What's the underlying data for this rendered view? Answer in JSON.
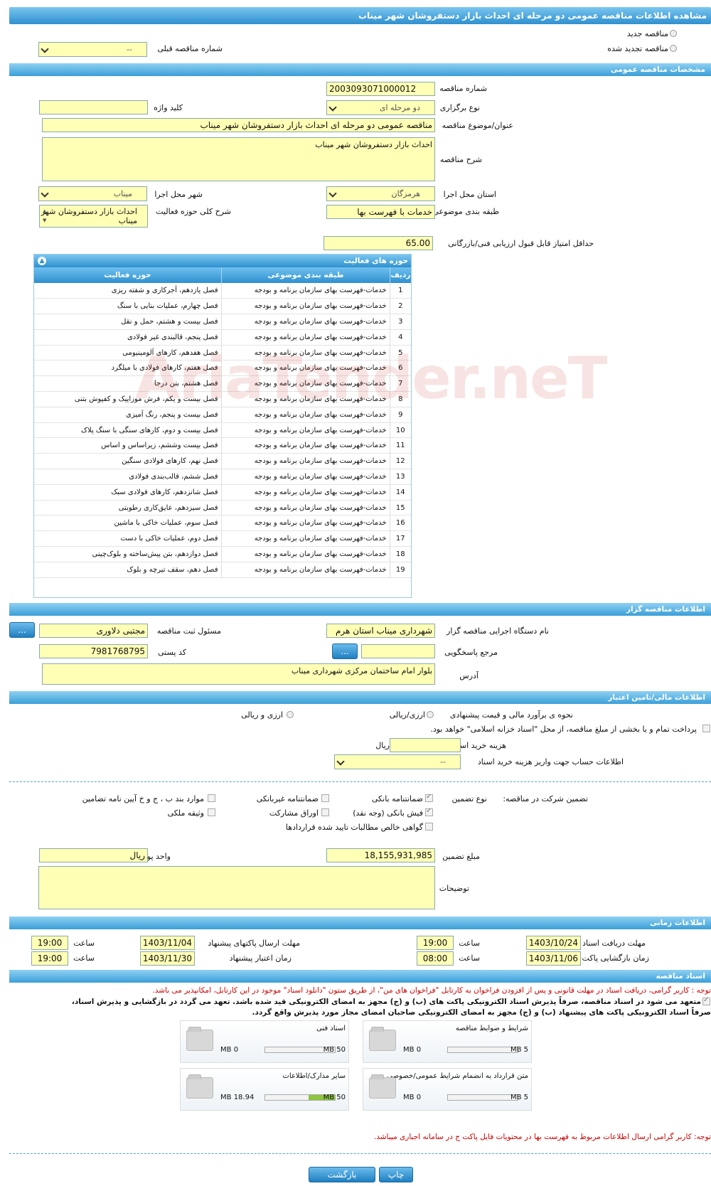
{
  "page": {
    "title": "مشاهده اطلاعات مناقصه عمومی دو مرحله ای احداث بازار دستفروشان شهر میناب"
  },
  "top": {
    "new_label": "مناقصه جدید",
    "renewed_label": "مناقصه تجدید شده",
    "prev_label": "شماره مناقصه قبلی",
    "prev_value": "--"
  },
  "general": {
    "header": "مشخصات مناقصه عمومی",
    "number_label": "شماره مناقصه",
    "number": "2003093071000012",
    "type_label": "نوع برگزاری",
    "type_value": "دو مرحله ای",
    "keyword_label": "کلید واژه",
    "keyword": "",
    "subject_label": "عنوان/موضوع مناقصه",
    "subject": "مناقصه عمومی دو مرحله ای احداث بازار دستفروشان شهر میناب",
    "desc_label": "شرح مناقصه",
    "desc": "احداث بازار دستفروشان شهر میناب",
    "province_label": "استان محل اجرا",
    "province": "هرمزگان",
    "city_label": "شهر محل اجرا",
    "city": "میناب",
    "category_label": "طبقه بندی موضوعی",
    "category": "خدمات با فهرست بها",
    "scope_label": "شرح کلی حوزه فعالیت",
    "scope": "احداث بازار دستفروشان شهر میناب",
    "minscore_label": "حداقل امتیاز قابل قبول ارزیابی فنی/بازرگانی",
    "minscore": "65.00"
  },
  "activity": {
    "title": "حوزه های فعالیت",
    "col_idx": "ردیف",
    "col_cat": "طبقه بندی موضوعی",
    "col_field": "حوزه فعالیت",
    "rows": [
      {
        "n": "1",
        "c": "خدمات-فهرست بهای سازمان برنامه و بودجه",
        "f": "فصل یازدهم، آجرکاری و شفته ریزی"
      },
      {
        "n": "2",
        "c": "خدمات-فهرست بهای سازمان برنامه و بودجه",
        "f": "فصل چهارم، عملیات بنایی با سنگ"
      },
      {
        "n": "3",
        "c": "خدمات-فهرست بهای سازمان برنامه و بودجه",
        "f": "فصل بیست و هشتم، حمل و نقل"
      },
      {
        "n": "4",
        "c": "خدمات-فهرست بهای سازمان برنامه و بودجه",
        "f": "فصل پنجم، قالبندی غیر فولادی"
      },
      {
        "n": "5",
        "c": "خدمات-فهرست بهای سازمان برنامه و بودجه",
        "f": "فصل هفدهم، کارهای آلومینیومی"
      },
      {
        "n": "6",
        "c": "خدمات-فهرست بهای سازمان برنامه و بودجه",
        "f": "فصل هفتم، کارهای فولادی با میلگرد"
      },
      {
        "n": "7",
        "c": "خدمات-فهرست بهای سازمان برنامه و بودجه",
        "f": "فصل هشتم، بتن درجا"
      },
      {
        "n": "8",
        "c": "خدمات-فهرست بهای سازمان برنامه و بودجه",
        "f": "فصل بیست و یکم، فرش موزاییک و کفپوش بتنی"
      },
      {
        "n": "9",
        "c": "خدمات-فهرست بهای سازمان برنامه و بودجه",
        "f": "فصل بیست و پنجم، رنگ آمیزی"
      },
      {
        "n": "10",
        "c": "خدمات-فهرست بهای سازمان برنامه و بودجه",
        "f": "فصل بیست و دوم، کارهای سنگی با سنگ پلاک"
      },
      {
        "n": "11",
        "c": "خدمات-فهرست بهای سازمان برنامه و بودجه",
        "f": "فصل بیست وششم، زیراساس و اساس"
      },
      {
        "n": "12",
        "c": "خدمات-فهرست بهای سازمان برنامه و بودجه",
        "f": "فصل نهم، کارهای فولادی سنگین"
      },
      {
        "n": "13",
        "c": "خدمات-فهرست بهای سازمان برنامه و بودجه",
        "f": "فصل ششم، قالب‌بندی فولادی"
      },
      {
        "n": "14",
        "c": "خدمات-فهرست بهای سازمان برنامه و بودجه",
        "f": "فصل شانزدهم، کارهای فولادی سبک"
      },
      {
        "n": "15",
        "c": "خدمات-فهرست بهای سازمان برنامه و بودجه",
        "f": "فصل سیزدهم، عایق‌کاری رطوبتی"
      },
      {
        "n": "16",
        "c": "خدمات-فهرست بهای سازمان برنامه و بودجه",
        "f": "فصل سوم، عملیات خاکی با ماشین"
      },
      {
        "n": "17",
        "c": "خدمات-فهرست بهای سازمان برنامه و بودجه",
        "f": "فصل دوم، عملیات خاکی با دست"
      },
      {
        "n": "18",
        "c": "خدمات-فهرست بهای سازمان برنامه و بودجه",
        "f": "فصل دوازدهم، بتن پیش‌ساخته و بلوک‌چینی"
      },
      {
        "n": "19",
        "c": "خدمات-فهرست بهای سازمان برنامه و بودجه",
        "f": "فصل دهم، سقف تیرچه و بلوک"
      }
    ]
  },
  "org": {
    "header": "اطلاعات مناقصه گزار",
    "name_label": "نام دستگاه اجرایی مناقصه گزار",
    "name": "شهرداری میناب استان هرم",
    "resp_label": "مسئول ثبت مناقصه",
    "resp": "مجتبی دلاوری",
    "ref_label": "مرجع پاسخگویی",
    "ref": "",
    "postal_label": "کد پستی",
    "postal": "7981768795",
    "address_label": "آدرس",
    "address": "بلوار امام ساختمان مرکزی شهرداری میناب",
    "dots": "..."
  },
  "finance": {
    "header": "اطلاعات مالی/تامین اعتبار",
    "method_label": "نحوه ی برآورد مالی و قیمت پیشنهادی",
    "opt1": "ارزی/ریالی",
    "opt2": "ارزی و ریالی",
    "treasury": "پرداخت تمام و یا بخشی از مبلغ مناقصه، از محل \"اسناد خزانه اسلامی\" خواهد بود.",
    "doc_cost_label": "هزینه خرید اسناد",
    "doc_cost": "",
    "rial": "ریال",
    "account_label": "اطلاعات حساب جهت واریز هزینه خرید اسناد",
    "account": "--",
    "guarantee_label": "تضمین شرکت در مناقصه:",
    "gtype_label": "نوع تضمین",
    "g1": "ضمانتنامه بانکی",
    "g2": "ضمانتنامه غیربانکی",
    "g3": "موارد بند ب ، ج و خ آیین نامه تضامین",
    "g4": "فیش بانکی (وجه نقد)",
    "g5": "اوراق مشارکت",
    "g6": "وثیقه ملکی",
    "g7": "گواهی خالص مطالبات تایید شده قراردادها",
    "amount_label": "مبلغ تضمین",
    "amount": "18,155,931,985",
    "currency_label": "واحد پول",
    "currency": "ریال",
    "notes_label": "توضیحات",
    "notes": ""
  },
  "timing": {
    "header": "اطلاعات زمانی",
    "get_label": "مهلت دریافت اسناد",
    "get_date": "1403/10/24",
    "time_label": "ساعت",
    "get_time": "19:00",
    "send_label": "مهلت ارسال پاکتهای پیشنهاد",
    "send_date": "1403/11/04",
    "send_time": "19:00",
    "open_label": "زمان بازگشایی پاکت ها",
    "open_date": "1403/11/06",
    "open_time": "08:00",
    "valid_label": "زمان اعتبار پیشنهاد",
    "valid_date": "1403/11/30",
    "valid_time": "19:00"
  },
  "docs": {
    "header": "اسناد مناقصه",
    "note1": "توجه : کاربر گرامی، دریافت اسناد در مهلت قانونی و پس از افزودن فراخوان به کارتابل \"فراخوان های من\"، از طریق ستون \"دانلود اسناد\" موجود در این کارتابل، امکانپذیر می باشد.",
    "note2": "متعهد می شود در اسناد مناقصه، صرفاً پذیرش اسناد الکترونیکی پاکت های (ب) و (ج) مجهز به امضای الکترونیکی قید شده باشد. تعهد می گردد در بازگشایی و پذیرش اسناد،",
    "note3": "صرفاً اسناد الکترونیکی پاکت های پیشنهاد (ب) و (ج) مجهز به امضای الکترونیکی صاحبان امضای مجاز مورد پذیرش واقع گردد.",
    "cards": [
      {
        "title": "شرایط و ضوابط مناقصه",
        "max": "5 MB",
        "min": "0 MB",
        "fill": 0
      },
      {
        "title": "اسناد فنی",
        "max": "50 MB",
        "min": "0 MB",
        "fill": 0
      },
      {
        "title": "متن قرارداد به انضمام شرایط عمومی/خصوصی",
        "max": "5 MB",
        "min": "0 MB",
        "fill": 0
      },
      {
        "title": "سایر مدارک/اطلاعات",
        "max": "50 MB",
        "min": "18.94 MB",
        "fill": 0.38
      }
    ],
    "footer_note": "توجه: کاربر گرامی ارسال اطلاعات مربوط به فهرست بها در محتویات فایل پاکت ج در سامانه اجباری میباشد."
  },
  "buttons": {
    "print": "چاپ",
    "back": "بازگشت"
  },
  "watermark": "AriaTender.neT"
}
